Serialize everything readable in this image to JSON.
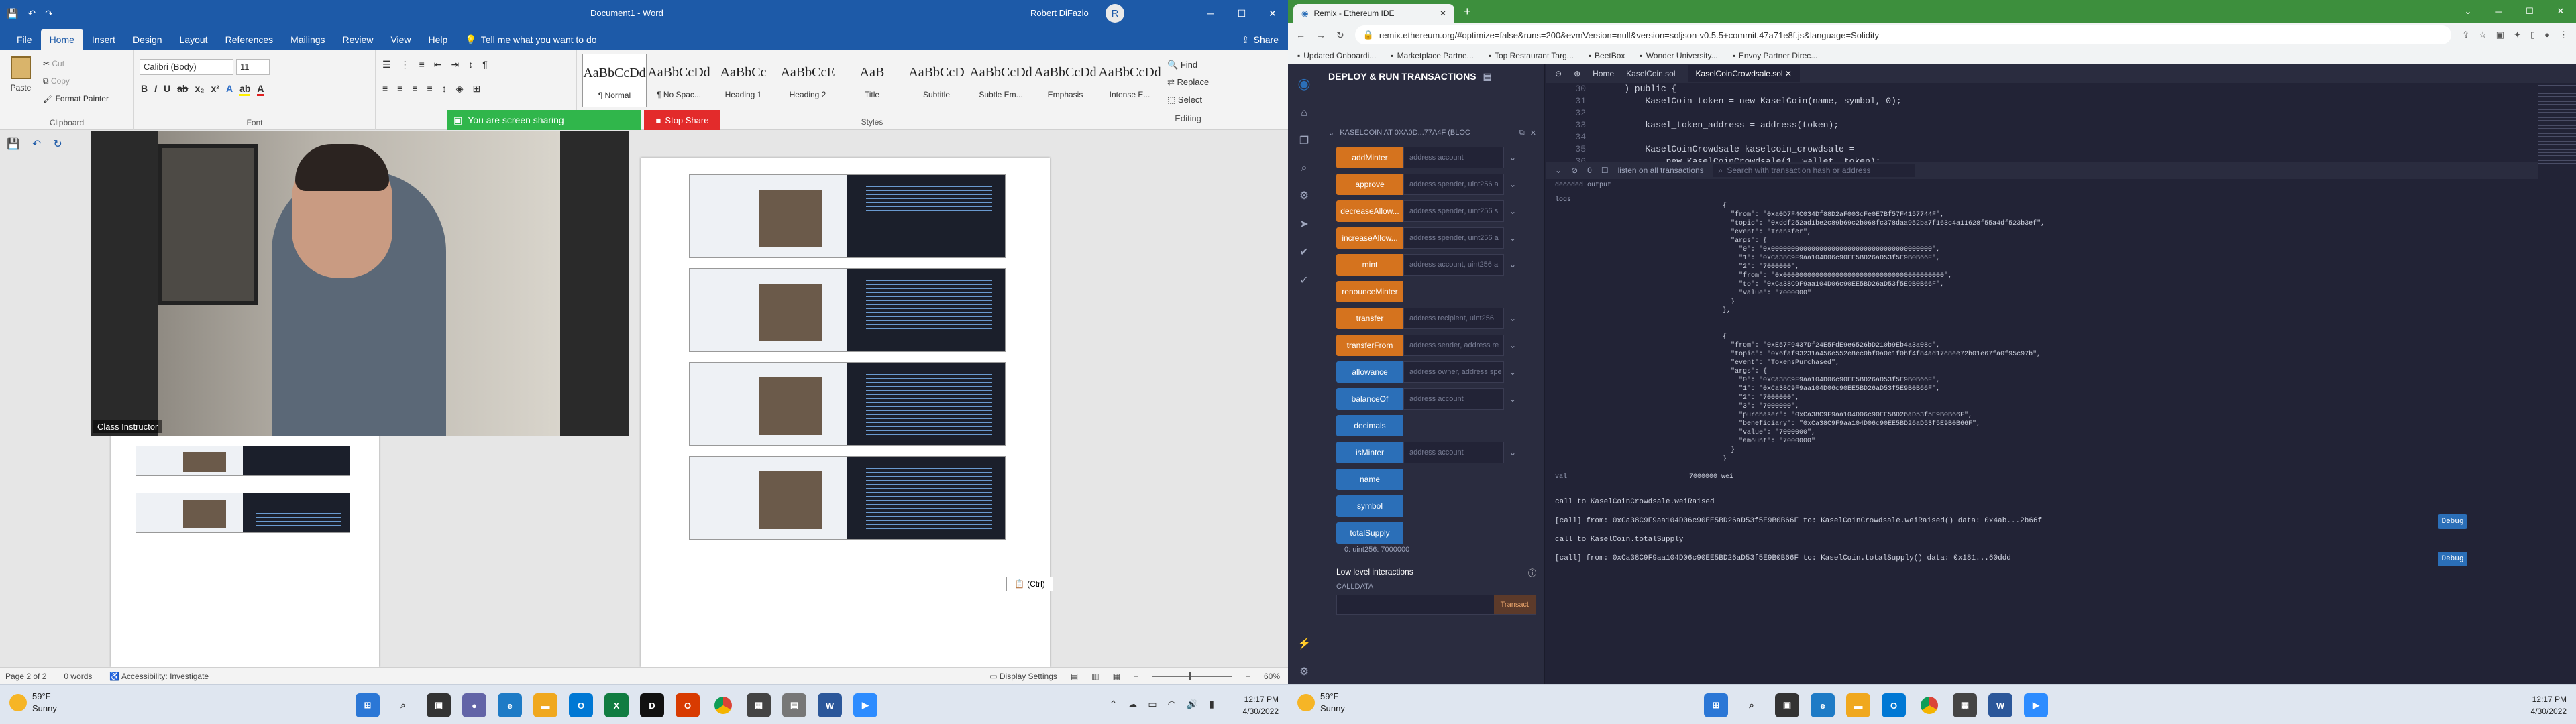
{
  "word": {
    "title": "Document1 - Word",
    "user": "Robert DiFazio",
    "user_initial": "R",
    "tabs": [
      "File",
      "Home",
      "Insert",
      "Design",
      "Layout",
      "References",
      "Mailings",
      "Review",
      "View",
      "Help"
    ],
    "tell_me": "Tell me what you want to do",
    "share_label": "Share",
    "clipboard": {
      "paste": "Paste",
      "cut": "Cut",
      "copy": "Copy",
      "format_painter": "Format Painter",
      "label": "Clipboard"
    },
    "font": {
      "family": "Calibri (Body)",
      "size": "11",
      "label": "Font"
    },
    "paragraph_label": "Paragraph",
    "styles": [
      {
        "preview": "AaBbCcDd",
        "name": "¶ Normal"
      },
      {
        "preview": "AaBbCcDd",
        "name": "¶ No Spac..."
      },
      {
        "preview": "AaBbCc",
        "name": "Heading 1"
      },
      {
        "preview": "AaBbCcE",
        "name": "Heading 2"
      },
      {
        "preview": "AaB",
        "name": "Title"
      },
      {
        "preview": "AaBbCcD",
        "name": "Subtitle"
      },
      {
        "preview": "AaBbCcDd",
        "name": "Subtle Em..."
      },
      {
        "preview": "AaBbCcDd",
        "name": "Emphasis"
      },
      {
        "preview": "AaBbCcDd",
        "name": "Intense E..."
      }
    ],
    "styles_label": "Styles",
    "editing": {
      "find": "Find",
      "replace": "Replace",
      "select": "Select",
      "label": "Editing"
    },
    "screen_sharing": "You are screen sharing",
    "stop_share": "Stop Share",
    "video_label": "Class Instructor",
    "paste_options": "(Ctrl)",
    "status": {
      "page": "Page 2 of 2",
      "words": "0 words",
      "accessibility": "Accessibility: Investigate",
      "display_settings": "Display Settings",
      "zoom": "60%"
    }
  },
  "taskbar_left": {
    "weather_temp": "59°F",
    "weather_desc": "Sunny",
    "time": "12:17 PM",
    "date": "4/30/2022"
  },
  "taskbar_right": {
    "weather_temp": "59°F",
    "weather_desc": "Sunny",
    "time": "12:17 PM",
    "date": "4/30/2022"
  },
  "chrome": {
    "tab_title": "Remix - Ethereum IDE",
    "url": "remix.ethereum.org/#optimize=false&runs=200&evmVersion=null&version=soljson-v0.5.5+commit.47a71e8f.js&language=Solidity",
    "bookmarks": [
      "Updated Onboardi...",
      "Marketplace Partne...",
      "Top Restaurant Targ...",
      "BeetBox",
      "Wonder University...",
      "Envoy Partner Direc..."
    ]
  },
  "remix": {
    "panel_title": "DEPLOY & RUN TRANSACTIONS",
    "contract": "KASELCOIN AT 0XA0D...77A4F (BLOC",
    "functions": [
      {
        "name": "addMinter",
        "placeholder": "address account",
        "kind": "orange"
      },
      {
        "name": "approve",
        "placeholder": "address spender, uint256 a",
        "kind": "orange"
      },
      {
        "name": "decreaseAllow...",
        "placeholder": "address spender, uint256 s",
        "kind": "orange"
      },
      {
        "name": "increaseAllow...",
        "placeholder": "address spender, uint256 a",
        "kind": "orange"
      },
      {
        "name": "mint",
        "placeholder": "address account, uint256 a",
        "kind": "orange"
      },
      {
        "name": "renounceMinter",
        "placeholder": "",
        "kind": "orange"
      },
      {
        "name": "transfer",
        "placeholder": "address recipient, uint256",
        "kind": "orange"
      },
      {
        "name": "transferFrom",
        "placeholder": "address sender, address re",
        "kind": "orange"
      },
      {
        "name": "allowance",
        "placeholder": "address owner, address spe",
        "kind": "blue"
      },
      {
        "name": "balanceOf",
        "placeholder": "address account",
        "kind": "blue"
      },
      {
        "name": "decimals",
        "placeholder": "",
        "kind": "blue"
      },
      {
        "name": "isMinter",
        "placeholder": "address account",
        "kind": "blue"
      },
      {
        "name": "name",
        "placeholder": "",
        "kind": "blue"
      },
      {
        "name": "symbol",
        "placeholder": "",
        "kind": "blue"
      },
      {
        "name": "totalSupply",
        "placeholder": "",
        "kind": "blue"
      }
    ],
    "decoded_total": "0: uint256: 7000000",
    "low_level": "Low level interactions",
    "calldata": "CALLDATA",
    "transact": "Transact",
    "editor_tabs": [
      "Home",
      "KaselCoin.sol",
      "KaselCoinCrowdsale.sol"
    ],
    "code": [
      {
        "n": "30",
        "t": "    ) public {"
      },
      {
        "n": "31",
        "t": "        KaselCoin token = new KaselCoin(name, symbol, 0);"
      },
      {
        "n": "32",
        "t": ""
      },
      {
        "n": "33",
        "t": "        kasel_token_address = address(token);"
      },
      {
        "n": "34",
        "t": ""
      },
      {
        "n": "35",
        "t": "        KaselCoinCrowdsale kaselcoin_crowdsale ="
      },
      {
        "n": "36",
        "t": "            new KaselCoinCrowdsale(1, wallet, token);"
      }
    ],
    "terminal": {
      "count": "0",
      "listen": "listen on all transactions",
      "search": "Search with transaction hash or address"
    },
    "decoded_output": "decoded output",
    "logs": "logs",
    "event1": "{\n  \"from\": \"0xa0D7F4C034Df88D2aF003cFe0E7Bf57F4157744F\",\n  \"topic\": \"0xddf252ad1be2c89b69c2b068fc378daa952ba7f163c4a11628f55a4df523b3ef\",\n  \"event\": \"Transfer\",\n  \"args\": {\n    \"0\": \"0x0000000000000000000000000000000000000000\",\n    \"1\": \"0xCa38C9F9aa104D06c90EE5BD26aD53f5E9B0B66F\",\n    \"2\": \"7000000\",\n    \"from\": \"0x0000000000000000000000000000000000000000\",\n    \"to\": \"0xCa38C9F9aa104D06c90EE5BD26aD53f5E9B0B66F\",\n    \"value\": \"7000000\"\n  }\n},",
    "event2": "{\n  \"from\": \"0xE57F9437Df24E5FdE9e6526bD210b9Eb4a3a08c\",\n  \"topic\": \"0x6faf93231a456e552e8ec0bf0a0e1f0bf4f84ad17c8ee72b01e67fa0f95c97b\",\n  \"event\": \"TokensPurchased\",\n  \"args\": {\n    \"0\": \"0xCa38C9F9aa104D06c90EE5BD26aD53f5E9B0B66F\",\n    \"1\": \"0xCa38C9F9aa104D06c90EE5BD26aD53f5E9B0B66F\",\n    \"2\": \"7000000\",\n    \"3\": \"7000000\",\n    \"purchaser\": \"0xCa38C9F9aa104D06c90EE5BD26aD53f5E9B0B66F\",\n    \"beneficiary\": \"0xCa38C9F9aa104D06c90EE5BD26aD53f5E9B0B66F\",\n    \"value\": \"7000000\",\n    \"amount\": \"7000000\"\n  }\n}",
    "value_label": "val",
    "value_text": "7000000 wei",
    "calls": [
      {
        "text": "call to KaselCoinCrowdsale.weiRaised",
        "debug": false
      },
      {
        "text": "[call] from: 0xCa38C9F9aa104D06c90EE5BD26aD53f5E9B0B66F to: KaselCoinCrowdsale.weiRaised() data: 0x4ab...2b66f",
        "debug": true
      },
      {
        "text": "call to KaselCoin.totalSupply",
        "debug": false
      },
      {
        "text": "[call] from: 0xCa38C9F9aa104D06c90EE5BD26aD53f5E9B0B66F to: KaselCoin.totalSupply() data: 0x181...60ddd",
        "debug": true
      }
    ],
    "debug_label": "Debug"
  }
}
